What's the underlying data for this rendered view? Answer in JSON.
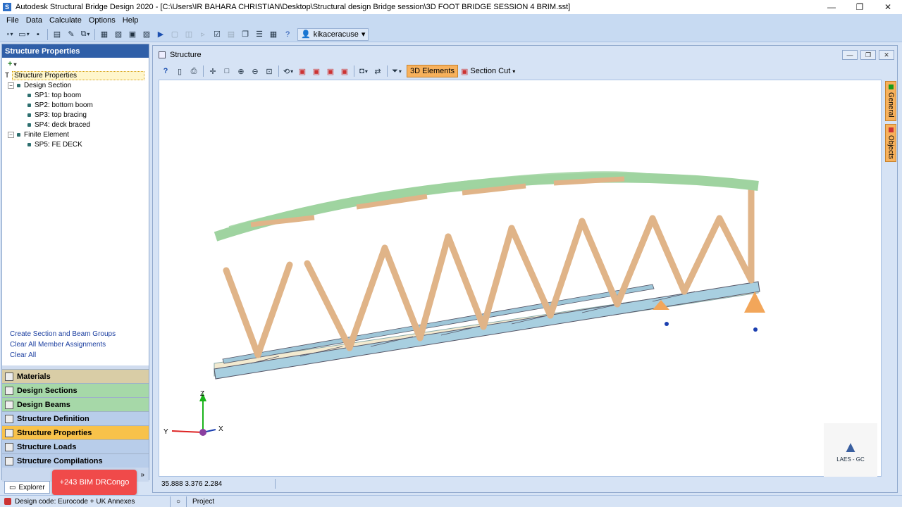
{
  "window": {
    "title": "Autodesk Structural Bridge Design 2020 - [C:\\Users\\IR BAHARA CHRISTIAN\\Desktop\\Structural design Bridge session\\3D FOOT BRIDGE SESSION 4  BRIM.sst]",
    "controls": [
      "—",
      "❐",
      "✕"
    ]
  },
  "menu": [
    "File",
    "Data",
    "Calculate",
    "Options",
    "Help"
  ],
  "toolbar": {
    "user": "kikaceracuse"
  },
  "left_panel": {
    "header": "Structure Properties",
    "add_symbol": "+",
    "tree": {
      "root": "Structure Properties",
      "groups": [
        {
          "label": "Design Section",
          "items": [
            "SP1: top boom",
            "SP2: bottom boom",
            "SP3: top bracing",
            "SP4: deck braced"
          ]
        },
        {
          "label": "Finite Element",
          "items": [
            "SP5: FE DECK"
          ]
        }
      ]
    },
    "links": [
      "Create Section and Beam Groups",
      "Clear All Member Assignments",
      "Clear All"
    ],
    "nav": [
      "Materials",
      "Design Sections",
      "Design Beams",
      "Structure Definition",
      "Structure Properties",
      "Structure Loads",
      "Structure Compilations"
    ],
    "explorer_tab": "Explorer"
  },
  "promo": "+243 BIM DRCongo",
  "structure_window": {
    "title": "Structure",
    "btn_3d": "3D Elements",
    "btn_section_cut": "Section Cut",
    "side_tabs": [
      "General",
      "Objects"
    ],
    "coords": "35.888  3.376  2.284",
    "axes": {
      "z": "Z",
      "y": "Y",
      "x": "X"
    },
    "logo_text": "LAES - GC"
  },
  "status": {
    "design_code": "Design code: Eurocode + UK Annexes",
    "project": "Project"
  },
  "colors": {
    "top_boom": "#9fd3a0",
    "timber": "#e0b488",
    "deck": "#a8cfe0",
    "accent": "#f7b15c"
  }
}
